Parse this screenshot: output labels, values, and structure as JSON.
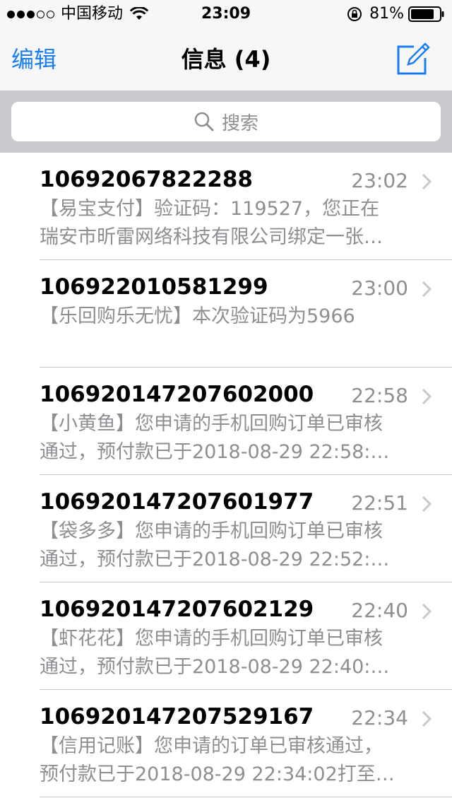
{
  "status": {
    "carrier": "中国移动",
    "time": "23:09",
    "battery": "81%"
  },
  "nav": {
    "edit": "编辑",
    "title": "信息 (4)"
  },
  "search": {
    "placeholder": "搜索"
  },
  "messages": [
    {
      "sender": "10692067822288",
      "time": "23:02",
      "line1": "【易宝支付】验证码：119527，您正在",
      "line2": "瑞安市昕雷网络科技有限公司绑定一张…"
    },
    {
      "sender": "106922010581299",
      "time": "23:00",
      "line1": "【乐回购乐无忧】本次验证码为5966",
      "line2": ""
    },
    {
      "sender": "106920147207602000",
      "time": "22:58",
      "line1": "【小黄鱼】您申请的手机回购订单已审核",
      "line2": "通过，预付款已于2018-08-29 22:58:…"
    },
    {
      "sender": "106920147207601977",
      "time": "22:51",
      "line1": "【袋多多】您申请的手机回购订单已审核",
      "line2": "通过，预付款已于2018-08-29 22:52:…"
    },
    {
      "sender": "106920147207602129",
      "time": "22:40",
      "line1": "【虾花花】您申请的手机回购订单已审核",
      "line2": "通过，预付款已于2018-08-29 22:40:…"
    },
    {
      "sender": "106920147207529167",
      "time": "22:34",
      "line1": "【信用记账】您申请的订单已审核通过，",
      "line2": "预付款已于2018-08-29 22:34:02打至…"
    }
  ],
  "colors": {
    "accent": "#1a7ef3",
    "secondary_text": "#8e8e93",
    "search_bg": "#c9c9ce"
  }
}
